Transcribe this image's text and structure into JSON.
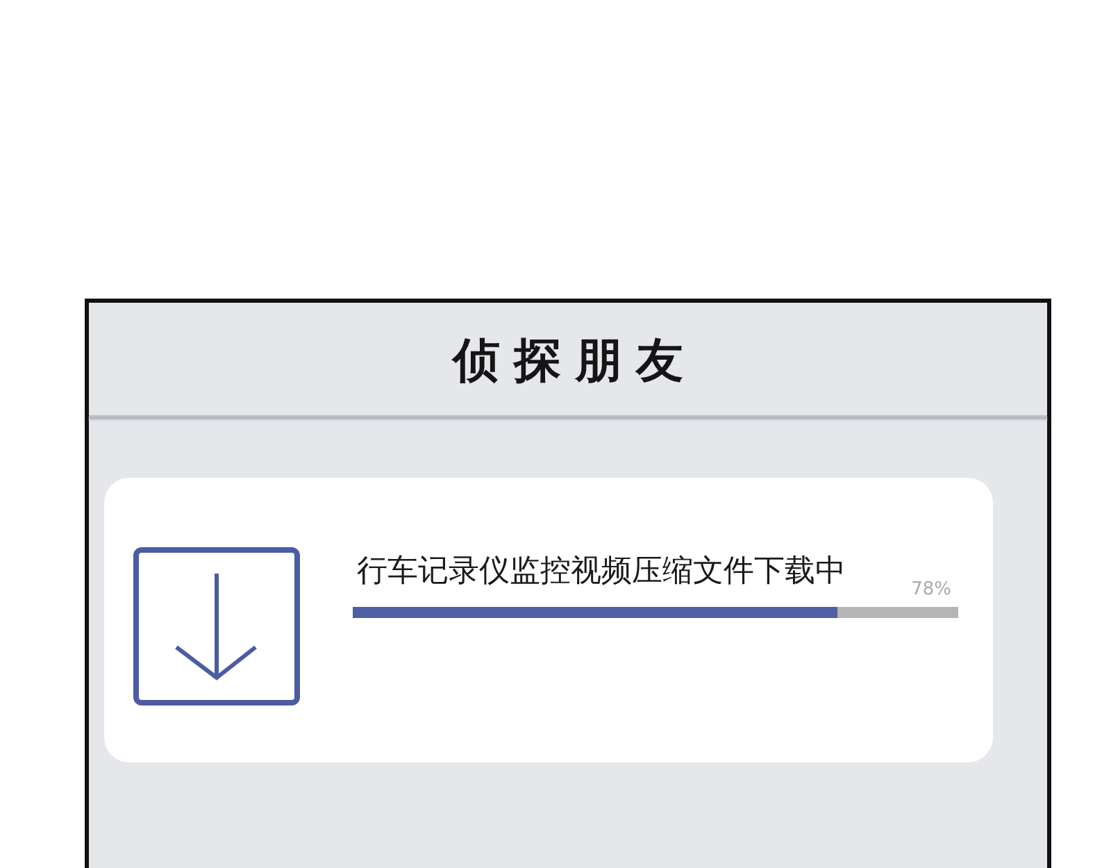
{
  "header": {
    "title": "侦探朋友"
  },
  "download": {
    "message": "行车记录仪监控视频压缩文件下载中",
    "percent": "78%",
    "level": 0.8
  }
}
